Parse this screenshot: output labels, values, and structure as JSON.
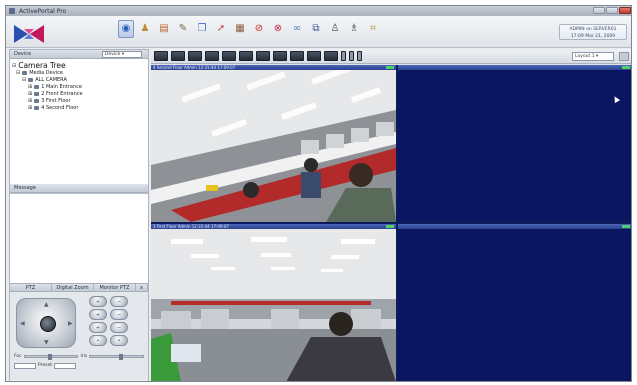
{
  "window": {
    "title": "ActivePortal Pro"
  },
  "banner": {
    "clock_line1": "ADMIN on SERVER01",
    "clock_line2": "17:09 Mar 21, 2009"
  },
  "toolbar_icons": [
    "monitor-icon",
    "person-icon",
    "playback-icon",
    "tools-icon",
    "window-icon",
    "export-icon",
    "grid-icon",
    "stop-icon",
    "alarm-icon",
    "link-icon",
    "copy-icon",
    "user-icon",
    "user-add-icon",
    "map-icon"
  ],
  "left_panel": {
    "tree_header": "Device",
    "tree_select": "Device ▾",
    "tree": {
      "root": "Camera Tree",
      "items": [
        {
          "level": 1,
          "label": "Media Device"
        },
        {
          "level": 2,
          "label": "ALL CAMERA"
        },
        {
          "level": 3,
          "label": "1 Main Entrance"
        },
        {
          "level": 3,
          "label": "2 Front Entrance"
        },
        {
          "level": 3,
          "label": "3 First Floor"
        },
        {
          "level": 3,
          "label": "4 Second Floor"
        }
      ]
    },
    "message_header": "Message",
    "ptz_tabs": [
      "PTZ",
      "Digital Zoom",
      "Monitor PTZ",
      "x"
    ],
    "ptz": {
      "focus_label": "Foc",
      "iris_label": "Iris",
      "preset_label": "Preset"
    }
  },
  "content": {
    "page_select": "Layout 1 ▾",
    "cameras": [
      {
        "title": "4 Second Floor   Admin 12:31:44 17:09:07",
        "status": "live"
      },
      {
        "title": "",
        "status": "empty"
      },
      {
        "title": "3 First Floor    Admin 12:31:44 17:09:07",
        "status": "live"
      },
      {
        "title": "",
        "status": "empty"
      }
    ]
  }
}
